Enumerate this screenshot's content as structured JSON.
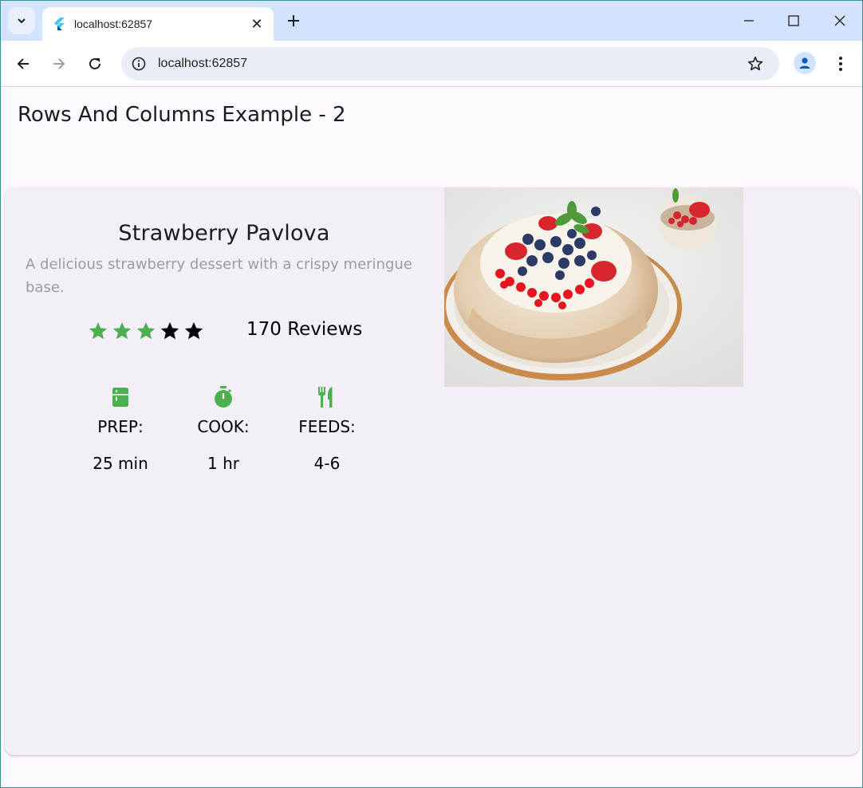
{
  "browser": {
    "tab_title": "localhost:62857",
    "url": "localhost:62857",
    "favicon": "flutter-logo-icon"
  },
  "page": {
    "title": "Rows And Columns Example - 2"
  },
  "recipe": {
    "name": "Strawberry Pavlova",
    "description": "A delicious strawberry dessert with a crispy meringue base.",
    "rating": 3,
    "rating_max": 5,
    "reviews": "170 Reviews",
    "accent_color": "#4caf50",
    "stats": [
      {
        "icon": "kitchen-icon",
        "label": "PREP:",
        "value": "25 min"
      },
      {
        "icon": "timer-icon",
        "label": "COOK:",
        "value": "1 hr"
      },
      {
        "icon": "restaurant-icon",
        "label": "FEEDS:",
        "value": "4-6"
      }
    ],
    "image": "pavlova-photo"
  }
}
